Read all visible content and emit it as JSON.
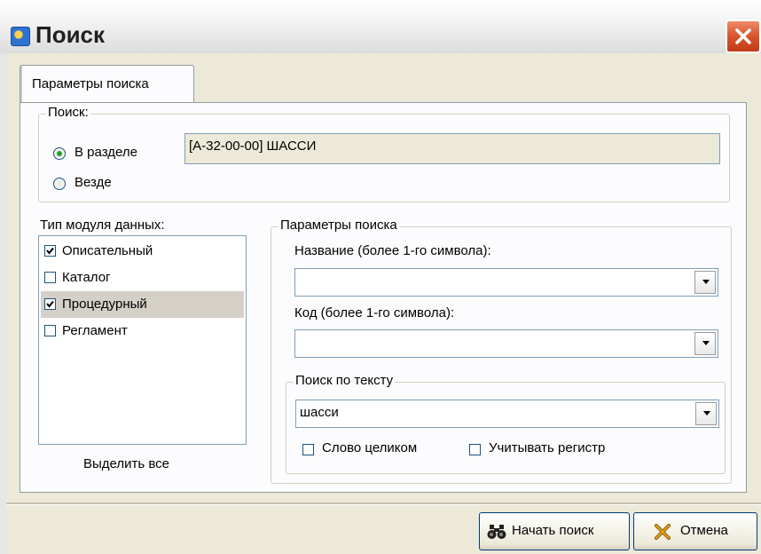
{
  "window": {
    "title": "Поиск"
  },
  "tabs": [
    {
      "label": "Параметры поиска"
    }
  ],
  "search_scope": {
    "legend": "Поиск:",
    "options": [
      {
        "label": "В разделе",
        "selected": true
      },
      {
        "label": "Везде",
        "selected": false
      }
    ],
    "section_value": "[A-32-00-00] ШАССИ"
  },
  "module_types": {
    "legend": "Тип модуля данных:",
    "items": [
      {
        "label": "Описательный",
        "checked": true,
        "highlighted": false
      },
      {
        "label": "Каталог",
        "checked": false,
        "highlighted": false
      },
      {
        "label": "Процедурный",
        "checked": true,
        "highlighted": true
      },
      {
        "label": "Регламент",
        "checked": false,
        "highlighted": false
      }
    ],
    "select_all_label": "Выделить все"
  },
  "search_params": {
    "legend": "Параметры поиска",
    "name_label": "Название (более 1-го символа):",
    "name_value": "",
    "code_label": "Код (более 1-го символа):",
    "code_value": "",
    "text_search": {
      "legend": "Поиск по тексту",
      "value": "шасси",
      "whole_word_label": "Слово целиком",
      "whole_word_checked": false,
      "match_case_label": "Учитывать регистр",
      "match_case_checked": false
    }
  },
  "buttons": {
    "start_label": "Начать поиск",
    "cancel_label": "Отмена"
  },
  "colors": {
    "accent": "#21a121",
    "close_red": "#d7542d",
    "dialog_bg": "#ece9d8"
  },
  "icons": {
    "app": "app-icon",
    "close": "close-icon",
    "start": "binoculars-icon",
    "cancel": "cancel-x-icon"
  }
}
